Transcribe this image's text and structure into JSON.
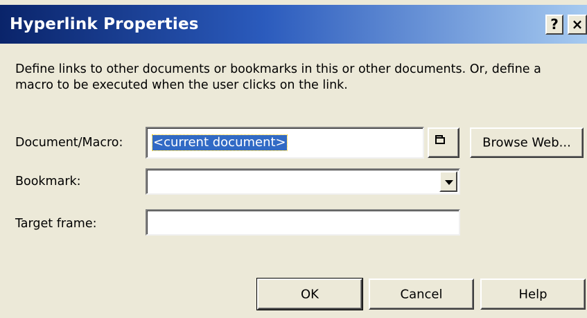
{
  "window": {
    "title": "Hyperlink Properties",
    "help_button": "?",
    "close_button": "×"
  },
  "description": "Define links to other documents or bookmarks in this or other documents. Or, define a macro to be executed when the user clicks on the link.",
  "form": {
    "document_macro": {
      "label": "Document/Macro:",
      "value": "<current document>"
    },
    "bookmark": {
      "label": "Bookmark:",
      "value": ""
    },
    "target_frame": {
      "label": "Target frame:",
      "value": ""
    }
  },
  "buttons": {
    "browse_folder_icon": "folder-icon",
    "browse_web": "Browse Web...",
    "ok": "OK",
    "cancel": "Cancel",
    "help": "Help"
  },
  "colors": {
    "titlebar_start": "#0a246a",
    "titlebar_end": "#a6caf0",
    "dialog_bg": "#ece9d8",
    "selection": "#316ac5"
  }
}
